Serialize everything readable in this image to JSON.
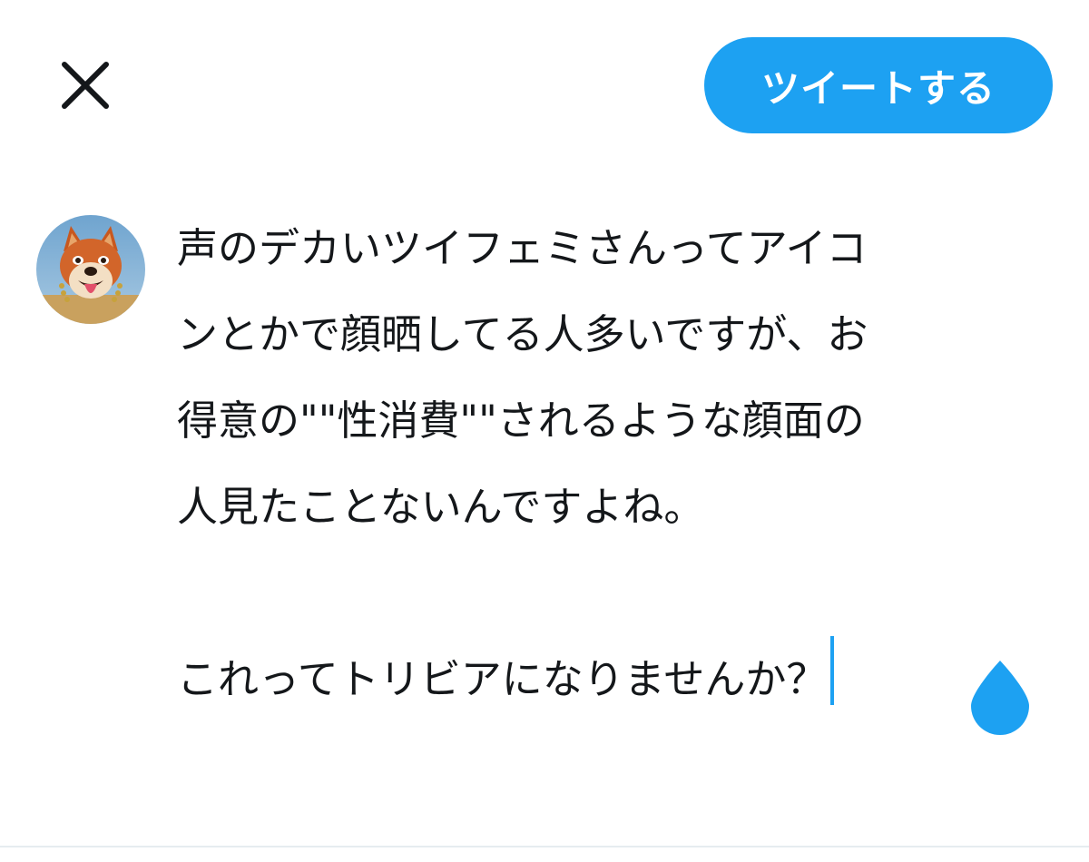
{
  "header": {
    "close_icon": "close-icon",
    "tweet_button_label": "ツイートする"
  },
  "colors": {
    "accent": "#1da1f2",
    "text": "#14171a",
    "divider": "#e6ecf0"
  },
  "composer": {
    "avatar_icon": "shiba-dog-avatar",
    "lines": [
      "声のデカいツイフェミさんってアイコ",
      "ンとかで顔晒してる人多いですが、お",
      "得意の\"\"性消費\"\"されるような顔面の",
      "人見たことないんですよね。",
      "",
      "これってトリビアになりませんか？"
    ]
  }
}
